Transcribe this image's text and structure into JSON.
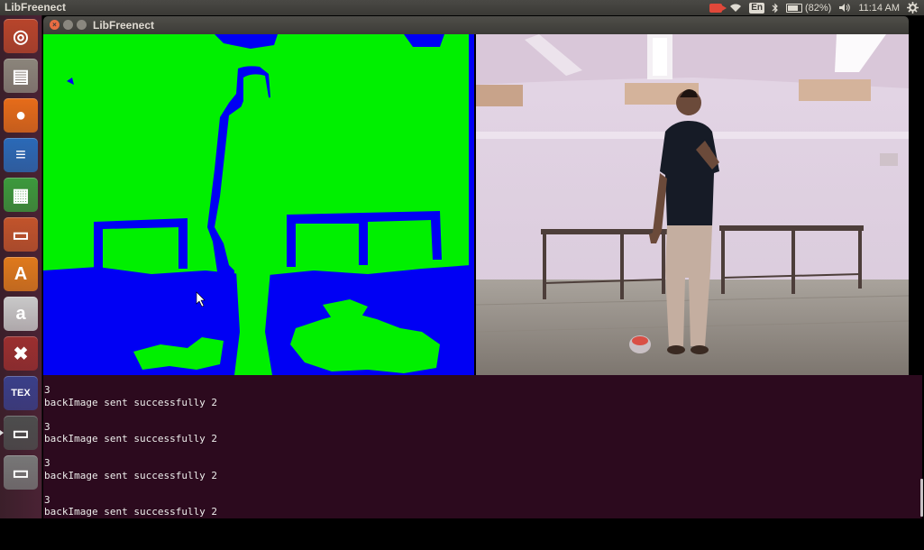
{
  "panel": {
    "active_app": "LibFreenect",
    "keyboard_layout": "En",
    "battery": "(82%)",
    "battery_level": 0.82,
    "clock": "11:14 AM",
    "icons": [
      "record-icon",
      "wifi-icon",
      "bluetooth-icon",
      "battery-icon",
      "volume-icon",
      "gear-icon"
    ]
  },
  "launcher": {
    "items": [
      {
        "name": "dash",
        "glyph": "◎",
        "color": "#b8452b"
      },
      {
        "name": "files",
        "glyph": "▤",
        "color": "#8b857b"
      },
      {
        "name": "firefox",
        "glyph": "●",
        "color": "#e66c19"
      },
      {
        "name": "writer",
        "glyph": "≡",
        "color": "#2a6ab8"
      },
      {
        "name": "calc",
        "glyph": "▦",
        "color": "#3c9a3c"
      },
      {
        "name": "impress",
        "glyph": "▭",
        "color": "#c2542b"
      },
      {
        "name": "software-center",
        "glyph": "A",
        "color": "#e07a1c"
      },
      {
        "name": "amazon",
        "glyph": "a",
        "color": "#c9c9c9"
      },
      {
        "name": "settings",
        "glyph": "✖",
        "color": "#9b2f2f"
      },
      {
        "name": "texmaker",
        "glyph": "TEX",
        "color": "#3a3f8a"
      },
      {
        "name": "terminal",
        "glyph": "▭",
        "color": "#4d4d4d"
      },
      {
        "name": "workspaces",
        "glyph": "▭",
        "color": "#777777"
      }
    ]
  },
  "window": {
    "title": "LibFreenect",
    "close_glyph": "×",
    "minimize_glyph": "",
    "maximize_glyph": ""
  },
  "depth_colors": {
    "near": "#00f000",
    "far": "#0000f4"
  },
  "terminal": {
    "lines": [
      "3",
      "backImage sent successfully 2",
      "",
      "3",
      "backImage sent successfully 2",
      "",
      "3",
      "backImage sent successfully 2",
      "",
      "3",
      "backImage sent successfully 2"
    ]
  }
}
